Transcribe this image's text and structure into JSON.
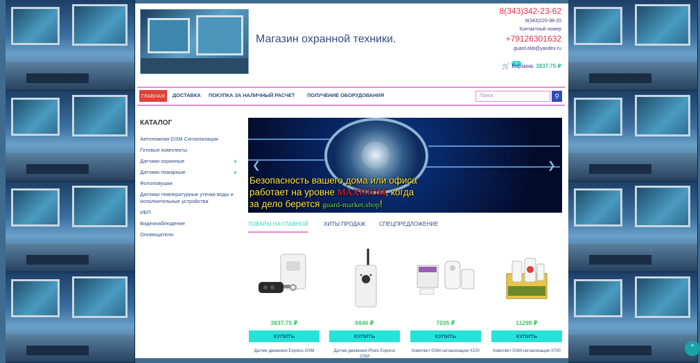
{
  "header": {
    "site_title": "Магазин охранной техники.",
    "phone_main": "8(343)342-23-62",
    "phone_secondary": "8(343)220-98-20",
    "contact_label": "Контактный номер",
    "mobile": "+79126301632",
    "email": "guard.ekb@yandex.ru"
  },
  "cart": {
    "badge": "0",
    "label": "Корзина:",
    "total": "3837.75 ₽"
  },
  "nav": {
    "items": [
      "ГЛАВНАЯ",
      "ДОСТАВКА",
      "ПОКУПКА ЗА НАЛИЧНЫЙ РАСЧЕТ",
      "ПОЛУЧЕНИЕ ОБОРУДОВАНИЯ"
    ],
    "search_placeholder": "Поиск",
    "search_icon": "search-icon"
  },
  "catalog": {
    "title": "КАТАЛОГ",
    "items": [
      "Автономная GSM Сигнализация",
      "Готовые комплекты",
      "Датчики охранные",
      "Датчики пожарные",
      "Фотоловушки",
      "Датчики температурные утечки воды и исполнительные устройства",
      "ИБП",
      "Видеонаблюдение",
      "Оповещатели"
    ]
  },
  "banner": {
    "line1": "Безопасность вашего дома или офиса",
    "line2_a": "работает на уровне",
    "line2_b": "MAXIMUM",
    "line2_c": ", когда",
    "line3_a": "за дело берется",
    "line3_b": "guard-market.shop",
    "line3_c": "!"
  },
  "tabs": [
    "ТОВАРЫ НА ГЛАВНОЙ",
    "ХИТЫ ПРОДАЖ",
    "СПЕЦПРЕДЛОЖЕНИЕ"
  ],
  "products": [
    {
      "price": "3837.75 ₽",
      "buy": "КУПИТЬ",
      "name": "Датчик движения Express GSM"
    },
    {
      "price": "6846 ₽",
      "buy": "КУПИТЬ",
      "name": "Датчик движения Photo Express GSM"
    },
    {
      "price": "7035 ₽",
      "buy": "КУПИТЬ",
      "name": "Комплект GSM-сигнализации X100"
    },
    {
      "price": "11298 ₽",
      "buy": "КУПИТЬ",
      "name": "Комплект GSM-сигнализации X700"
    }
  ],
  "colors": {
    "accent_pink": "#e58ad7",
    "accent_teal": "#27e2d6",
    "price_green": "#3cc46a",
    "nav_active_red": "#e0403a"
  }
}
